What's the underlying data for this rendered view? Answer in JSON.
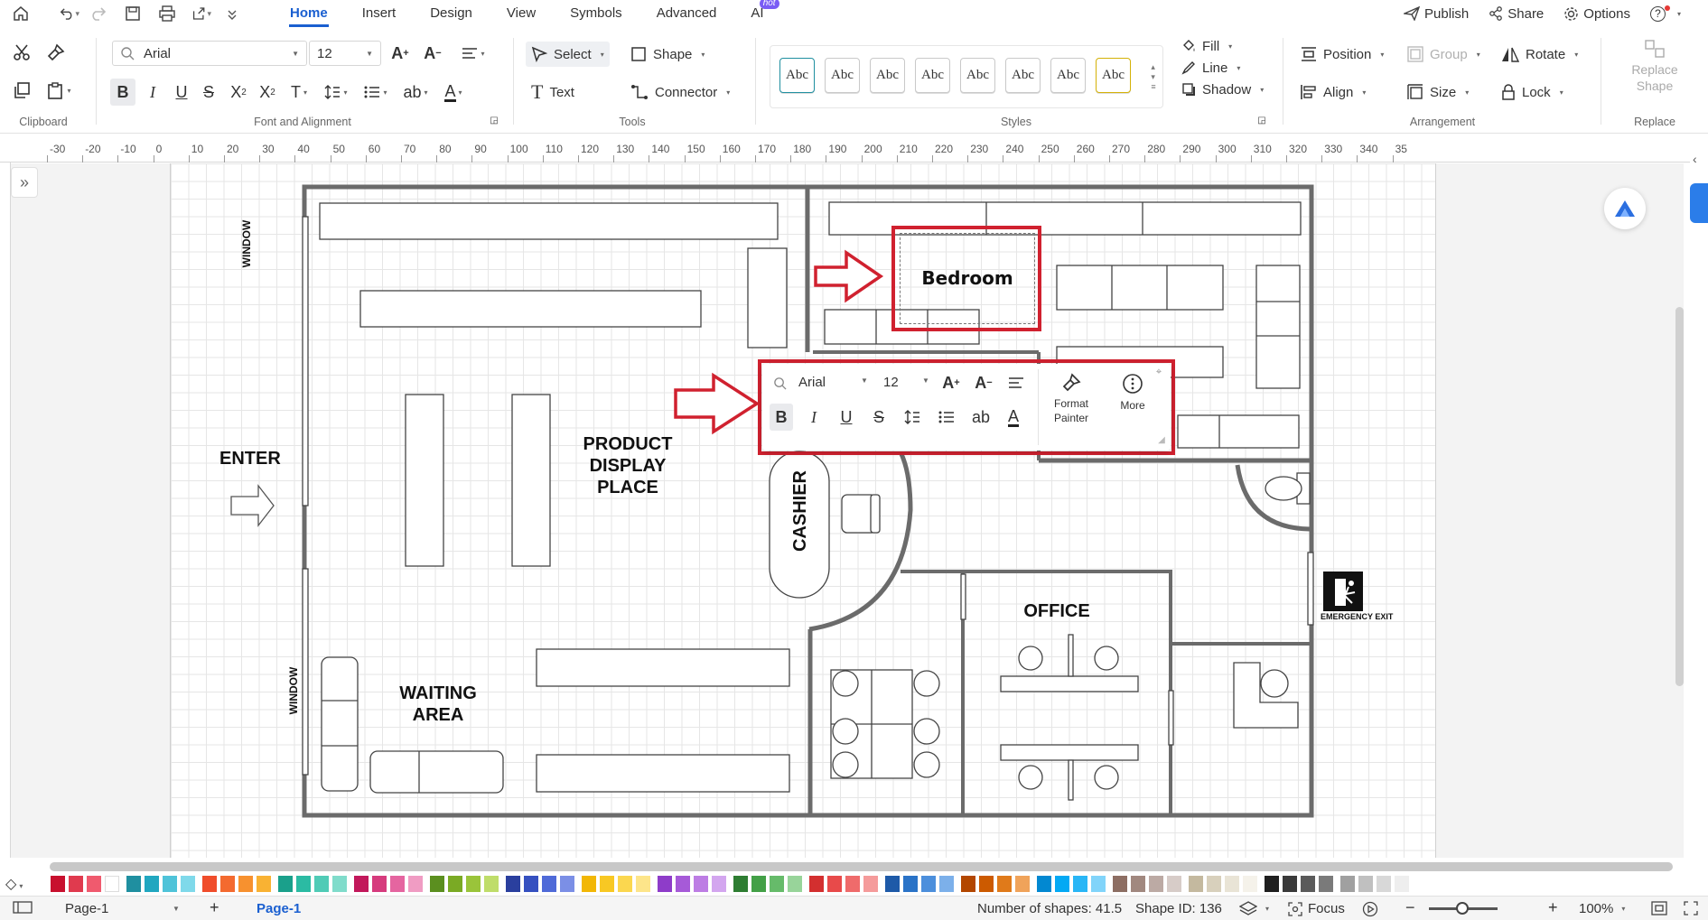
{
  "menubar": {
    "tabs": [
      {
        "label": "Home",
        "active": true
      },
      {
        "label": "Insert"
      },
      {
        "label": "Design"
      },
      {
        "label": "View"
      },
      {
        "label": "Symbols"
      },
      {
        "label": "Advanced"
      },
      {
        "label": "AI",
        "badge": "hot"
      }
    ],
    "publish": "Publish",
    "share": "Share",
    "options": "Options",
    "help": "?"
  },
  "ribbon": {
    "clipboard_label": "Clipboard",
    "font": {
      "family": "Arial",
      "size": "12",
      "group_label": "Font and Alignment"
    },
    "tools": {
      "select": "Select",
      "shape": "Shape",
      "text": "Text",
      "connector": "Connector",
      "group_label": "Tools"
    },
    "styles": {
      "swatches": [
        "Abc",
        "Abc",
        "Abc",
        "Abc",
        "Abc",
        "Abc",
        "Abc",
        "Abc"
      ],
      "fill": "Fill",
      "line": "Line",
      "shadow": "Shadow",
      "group_label": "Styles"
    },
    "arrangement": {
      "position": "Position",
      "group": "Group",
      "rotate": "Rotate",
      "align": "Align",
      "size": "Size",
      "lock": "Lock",
      "group_label": "Arrangement"
    },
    "replace": {
      "button_line1": "Replace",
      "button_line2": "Shape",
      "group_label": "Replace"
    }
  },
  "ruler": {
    "ticks": [
      "-30",
      "-20",
      "-10",
      "0",
      "10",
      "20",
      "30",
      "40",
      "50",
      "60",
      "70",
      "80",
      "90",
      "100",
      "110",
      "120",
      "130",
      "140",
      "150",
      "160",
      "170",
      "180",
      "190",
      "200",
      "210",
      "220",
      "230",
      "240",
      "250",
      "260",
      "270",
      "280",
      "290",
      "300",
      "310",
      "320",
      "330",
      "340",
      "35"
    ]
  },
  "floorplan": {
    "enter": "ENTER",
    "window_top": "WINDOW",
    "window_bottom": "WINDOW",
    "product_display": [
      "PRODUCT",
      "DISPLAY",
      "PLACE"
    ],
    "waiting_area": [
      "WAITING",
      "AREA"
    ],
    "cashier": "CASHIER",
    "office": "OFFICE",
    "emergency_exit": "EMERGENCY EXIT",
    "editing_text": "Bedroom"
  },
  "float_toolbar": {
    "font": "Arial",
    "size": "12",
    "format_painter_line1": "Format",
    "format_painter_line2": "Painter",
    "more": "More"
  },
  "palette": {
    "colors": [
      "#c8102e",
      "#e03a4e",
      "#f05a6e",
      "#ffffff",
      "#1f8fa0",
      "#21a7c0",
      "#4fc3d9",
      "#7fd9ea",
      "#f04d2b",
      "#f46a2f",
      "#f7912f",
      "#f9b233",
      "#1aa08b",
      "#2bbba3",
      "#50cbb6",
      "#80dccb",
      "#c2185b",
      "#d63b7d",
      "#e565a0",
      "#f09cc3",
      "#5b8f1f",
      "#7aaa24",
      "#9ac43a",
      "#bfdd6a",
      "#2a3f9e",
      "#3550c0",
      "#4f6ad8",
      "#7b8fe6",
      "#f2b705",
      "#f8c823",
      "#fbd74f",
      "#fde58a",
      "#8e3cc9",
      "#a65ad8",
      "#bd7de4",
      "#d3a6ef",
      "#2e7d32",
      "#43a047",
      "#66bb6a",
      "#98d49a",
      "#d32f2f",
      "#e84a4a",
      "#ef6b6b",
      "#f59b9b",
      "#1e5aa8",
      "#2a73c7",
      "#4c8fdc",
      "#7cb0ea",
      "#b34700",
      "#cc5a00",
      "#e07a1a",
      "#f0a35a",
      "#0288d1",
      "#03a9f4",
      "#29b6f6",
      "#81d4fa",
      "#8d6e63",
      "#a1887f",
      "#bcaaa4",
      "#d7ccc8",
      "#c4b99f",
      "#d8d0bc",
      "#e9e4d6",
      "#f5f2ea",
      "#1f1f1f",
      "#3a3a3a",
      "#5a5a5a",
      "#7a7a7a",
      "#a0a0a0",
      "#c0c0c0",
      "#d8d8d8",
      "#eeeeee"
    ]
  },
  "status": {
    "page_selector": "Page-1",
    "page_tab": "Page-1",
    "shape_count": "Number of shapes: 41.5",
    "shape_id": "Shape ID: 136",
    "focus": "Focus",
    "zoom": "100%"
  }
}
